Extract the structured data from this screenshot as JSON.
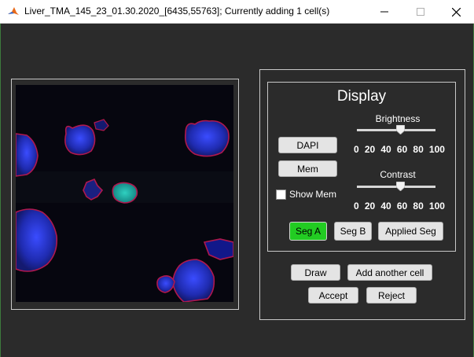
{
  "window": {
    "title": "Liver_TMA_145_23_01.30.2020_[6435,55763]; Currently adding 1 cell(s)",
    "minimize_icon": "minimize-icon",
    "maximize_icon": "maximize-icon",
    "close_icon": "close-icon"
  },
  "display": {
    "title": "Display",
    "brightness": {
      "label": "Brightness",
      "value": 55,
      "ticks": [
        "0",
        "20",
        "40",
        "60",
        "80",
        "100"
      ]
    },
    "contrast": {
      "label": "Contrast",
      "value": 55,
      "ticks": [
        "0",
        "20",
        "40",
        "60",
        "80",
        "100"
      ]
    },
    "dapi_label": "DAPI",
    "mem_label": "Mem",
    "show_mem_label": "Show Mem",
    "show_mem_checked": false,
    "seg_a_label": "Seg A",
    "seg_b_label": "Seg B",
    "applied_seg_label": "Applied Seg",
    "active_seg": "Seg A"
  },
  "actions": {
    "draw_label": "Draw",
    "add_cell_label": "Add another cell",
    "accept_label": "Accept",
    "reject_label": "Reject"
  },
  "colors": {
    "background": "#2b2b2b",
    "active_button": "#22cc22",
    "nucleus": "#2b3cd6",
    "membrane": "#c2185b",
    "selected_cell": "#1a8f8f"
  }
}
